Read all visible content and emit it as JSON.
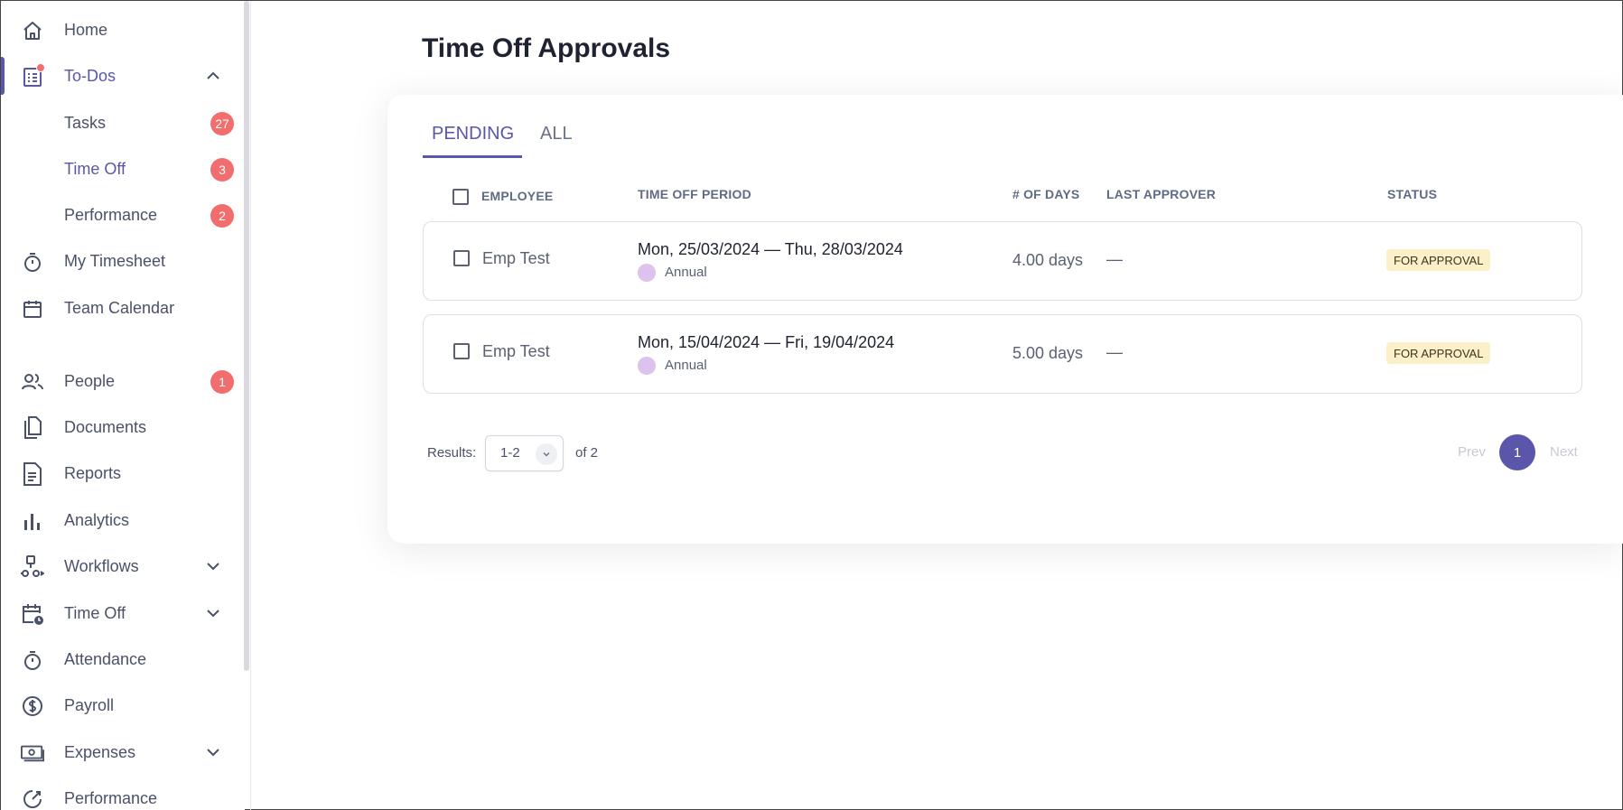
{
  "sidebar": {
    "home": "Home",
    "todos": "To-Dos",
    "tasks": "Tasks",
    "tasks_count": "27",
    "time_off_sub": "Time Off",
    "time_off_count": "3",
    "performance_sub": "Performance",
    "performance_count": "2",
    "my_timesheet": "My Timesheet",
    "team_calendar": "Team Calendar",
    "people": "People",
    "people_count": "1",
    "documents": "Documents",
    "reports": "Reports",
    "analytics": "Analytics",
    "workflows": "Workflows",
    "time_off": "Time Off",
    "attendance": "Attendance",
    "payroll": "Payroll",
    "expenses": "Expenses",
    "performance": "Performance"
  },
  "page": {
    "title": "Time Off Approvals"
  },
  "tabs": {
    "pending": "PENDING",
    "all": "ALL"
  },
  "table": {
    "headers": {
      "employee": "EMPLOYEE",
      "period": "TIME OFF PERIOD",
      "days": "# OF DAYS",
      "approver": "LAST APPROVER",
      "status": "STATUS"
    },
    "rows": [
      {
        "employee": "Emp Test",
        "period": "Mon, 25/03/2024 — Thu, 28/03/2024",
        "type": "Annual",
        "days": "4.00 days",
        "approver": "—",
        "status": "FOR APPROVAL"
      },
      {
        "employee": "Emp Test",
        "period": "Mon, 15/04/2024 — Fri, 19/04/2024",
        "type": "Annual",
        "days": "5.00 days",
        "approver": "—",
        "status": "FOR APPROVAL"
      }
    ]
  },
  "pagination": {
    "results_label": "Results:",
    "range": "1-2",
    "of_label": "of 2",
    "prev": "Prev",
    "page": "1",
    "next": "Next"
  },
  "colors": {
    "accent": "#5a56a9",
    "badge": "#f26d6d",
    "status_bg": "#fbf0c7",
    "leave_type_dot": "#dcc2ec"
  }
}
